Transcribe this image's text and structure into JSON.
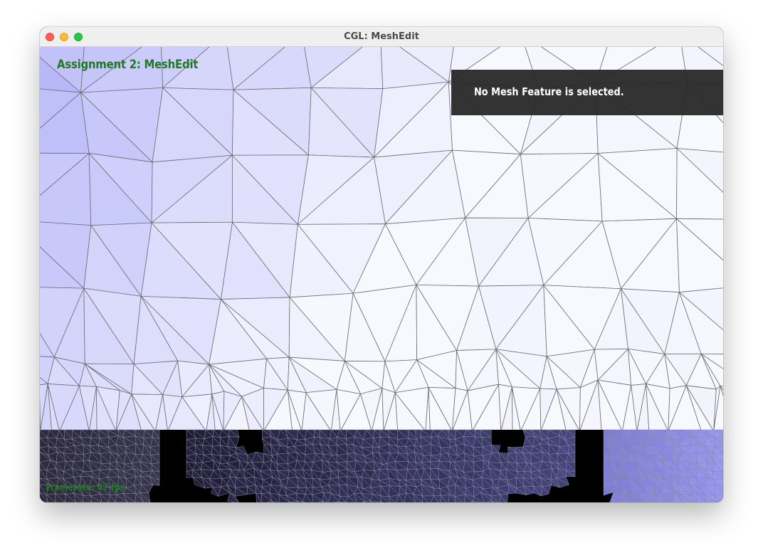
{
  "window": {
    "title": "CGL: MeshEdit"
  },
  "overlay": {
    "heading": "Assignment 2: MeshEdit",
    "selection_message": "No Mesh Feature is selected.",
    "fps_text": "Framerate: 47 fps"
  },
  "colors": {
    "heading_text": "#1e7a23",
    "panel_bg": "#282828",
    "mesh_edge": "#6e6e78",
    "face_light": "#f8f8ff",
    "face_dark": "#b4b4f8",
    "lower_mesh": "#1c1a2e"
  },
  "icons": [
    "close-button",
    "minimize-button",
    "zoom-button"
  ]
}
